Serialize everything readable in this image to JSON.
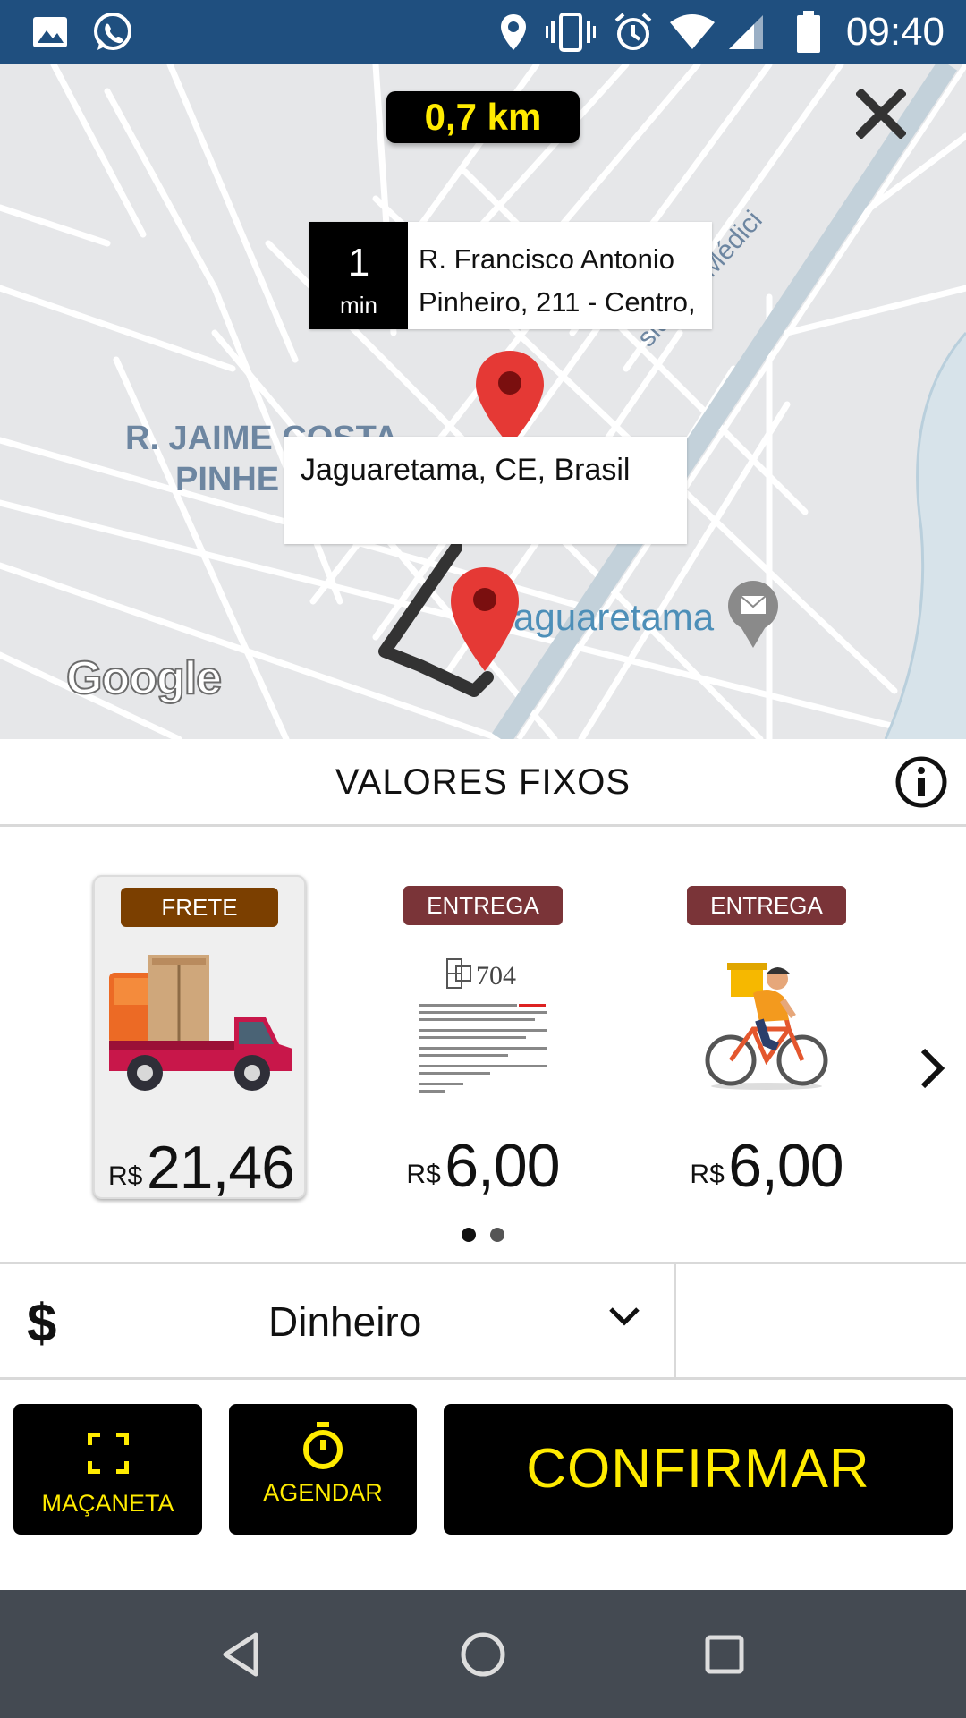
{
  "status_bar": {
    "time": "09:40",
    "icons": [
      "image-icon",
      "whatsapp-icon",
      "location-icon",
      "vibrate-icon",
      "alarm-icon",
      "wifi-icon",
      "signal-icon",
      "battery-icon"
    ]
  },
  "map": {
    "distance": "0,7 km",
    "eta": {
      "value": "1",
      "unit": "min"
    },
    "origin_address_line1": "R. Francisco Antonio",
    "origin_address_line2": "Pinheiro, 211 - Centro,",
    "destination_address": "Jaguaretama, CE, Brasil",
    "street_label_line1": "R. JAIME COSTA",
    "street_label_line2": "PINHE",
    "road_label": "sidente Médici",
    "city_label": "aguaretama",
    "attribution": "Google",
    "pin_color": "#e53935",
    "route_color": "#333333"
  },
  "fixed_values": {
    "title": "VALORES FIXOS",
    "options": [
      {
        "badge": "FRETE",
        "badge_color": "#7b3f00",
        "currency": "R$",
        "price": "21,46",
        "image": "pickup-truck-icon",
        "selected": true
      },
      {
        "badge": "ENTREGA",
        "badge_color": "#7a3438",
        "currency": "R$",
        "price": "6,00",
        "image": "flyer-document-icon",
        "selected": false
      },
      {
        "badge": "ENTREGA",
        "badge_color": "#7a3438",
        "currency": "R$",
        "price": "6,00",
        "image": "courier-bicycle-icon",
        "selected": false
      }
    ],
    "page_count": 2,
    "current_page": 1
  },
  "payment": {
    "symbol": "$",
    "method": "Dinheiro"
  },
  "actions": {
    "handle_label": "MAÇANETA",
    "schedule_label": "AGENDAR",
    "confirm_label": "CONFIRMAR",
    "accent": "#ffeb00"
  },
  "doc_flyer": {
    "heading": "704"
  }
}
